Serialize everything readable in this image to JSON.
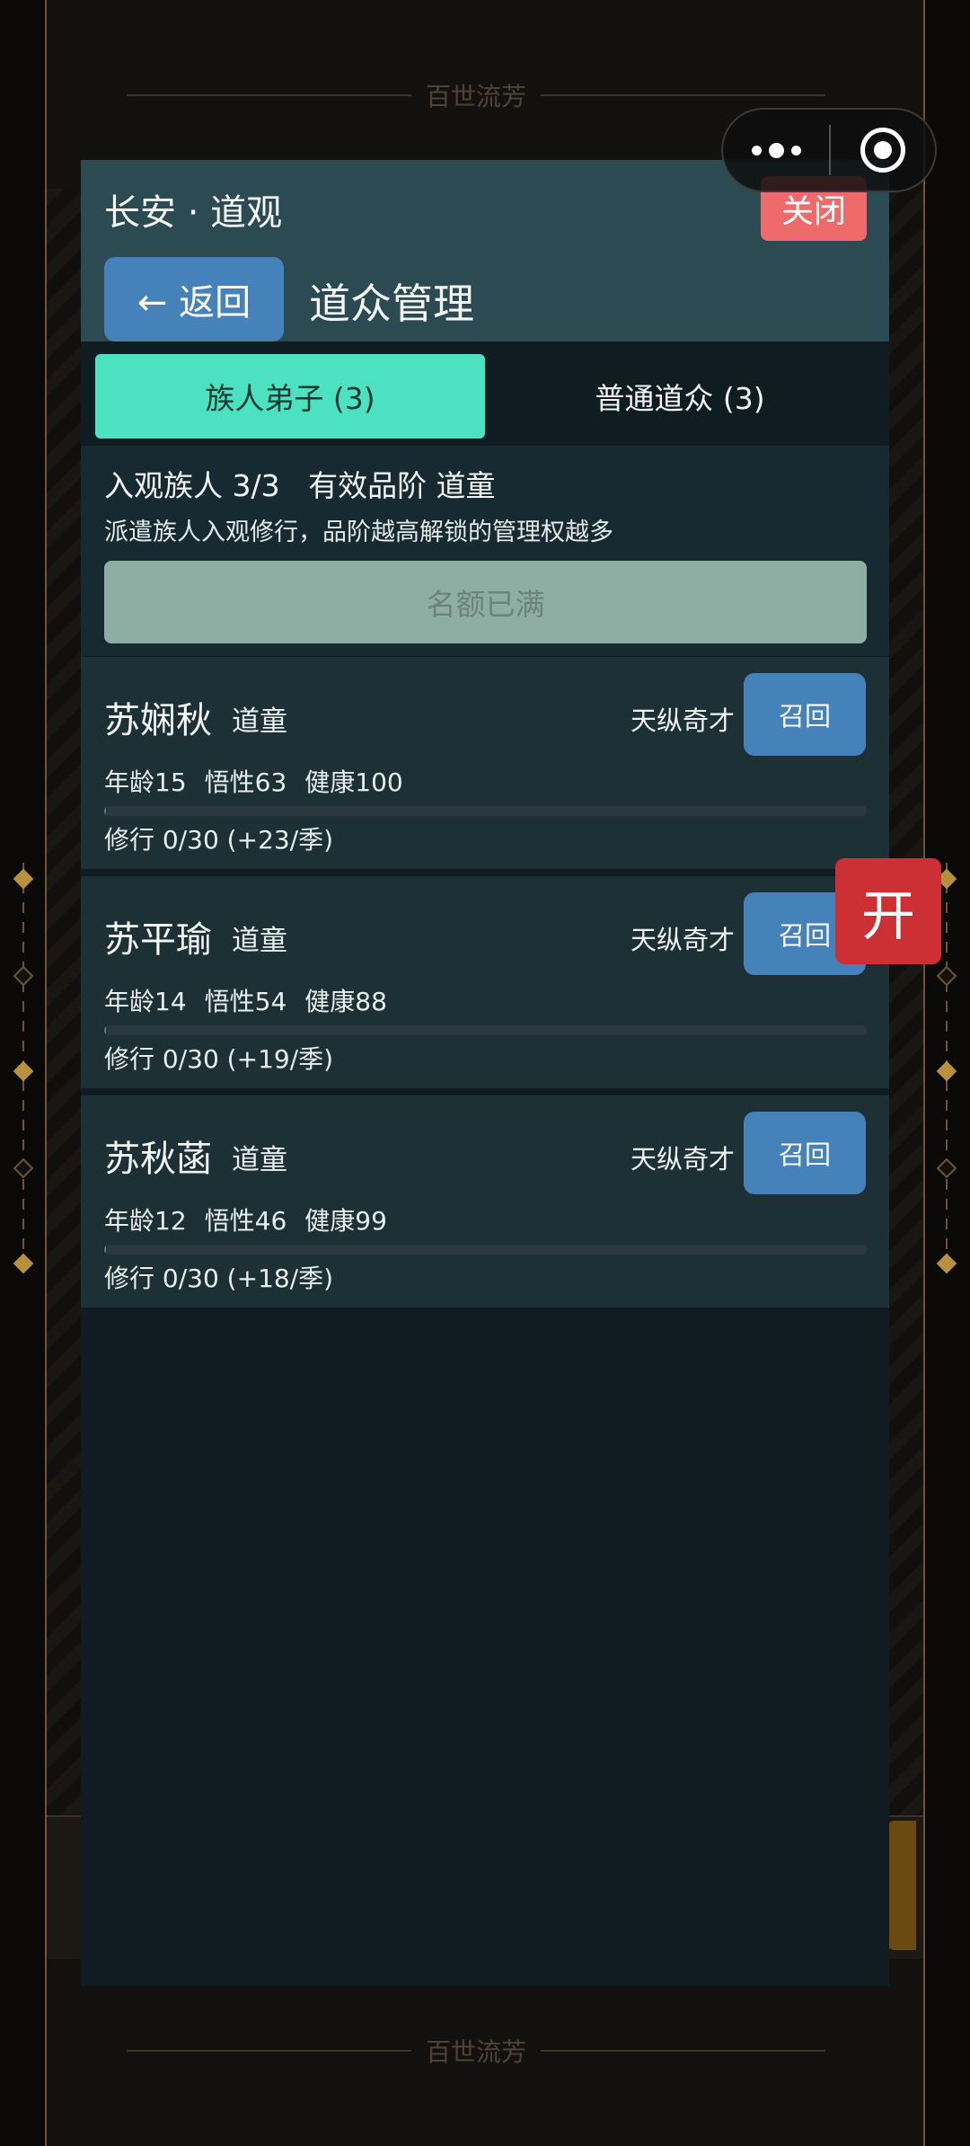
{
  "background": {
    "banner_text": "百世流芳"
  },
  "capsule": {
    "more_icon": "more-dots-icon",
    "close_icon": "target-circle-icon"
  },
  "modal": {
    "title": "长安 · 道观",
    "close_label": "关闭",
    "back_label": "← 返回",
    "subtitle": "道众管理",
    "tabs": [
      {
        "label": "族人弟子 (3)",
        "active": true
      },
      {
        "label": "普通道众 (3)",
        "active": false
      }
    ],
    "summary": {
      "line1": "入观族人 3/3   有效品阶 道童",
      "line2": "派遣族人入观修行，品阶越高解锁的管理权越多",
      "full_label": "名额已满"
    },
    "members": [
      {
        "name": "苏娴秋",
        "rank": "道童",
        "talent": "天纵奇才",
        "recall_label": "召回",
        "age": "年龄15",
        "insight": "悟性63",
        "health": "健康100",
        "practice": "修行 0/30 (+23/季)",
        "progress": 0
      },
      {
        "name": "苏平瑜",
        "rank": "道童",
        "talent": "天纵奇才",
        "recall_label": "召回",
        "age": "年龄14",
        "insight": "悟性54",
        "health": "健康88",
        "practice": "修行 0/30 (+19/季)",
        "progress": 0
      },
      {
        "name": "苏秋菡",
        "rank": "道童",
        "talent": "天纵奇才",
        "recall_label": "召回",
        "age": "年龄12",
        "insight": "悟性46",
        "health": "健康99",
        "practice": "修行 0/30 (+18/季)",
        "progress": 0
      }
    ]
  },
  "float_button": {
    "label": "开"
  },
  "colors": {
    "header_bg": "#2c4a51",
    "tab_active": "#4ce2c1",
    "primary_button": "#4582ba",
    "close_button": "#ef6a6a",
    "float_button": "#cc2f34"
  }
}
